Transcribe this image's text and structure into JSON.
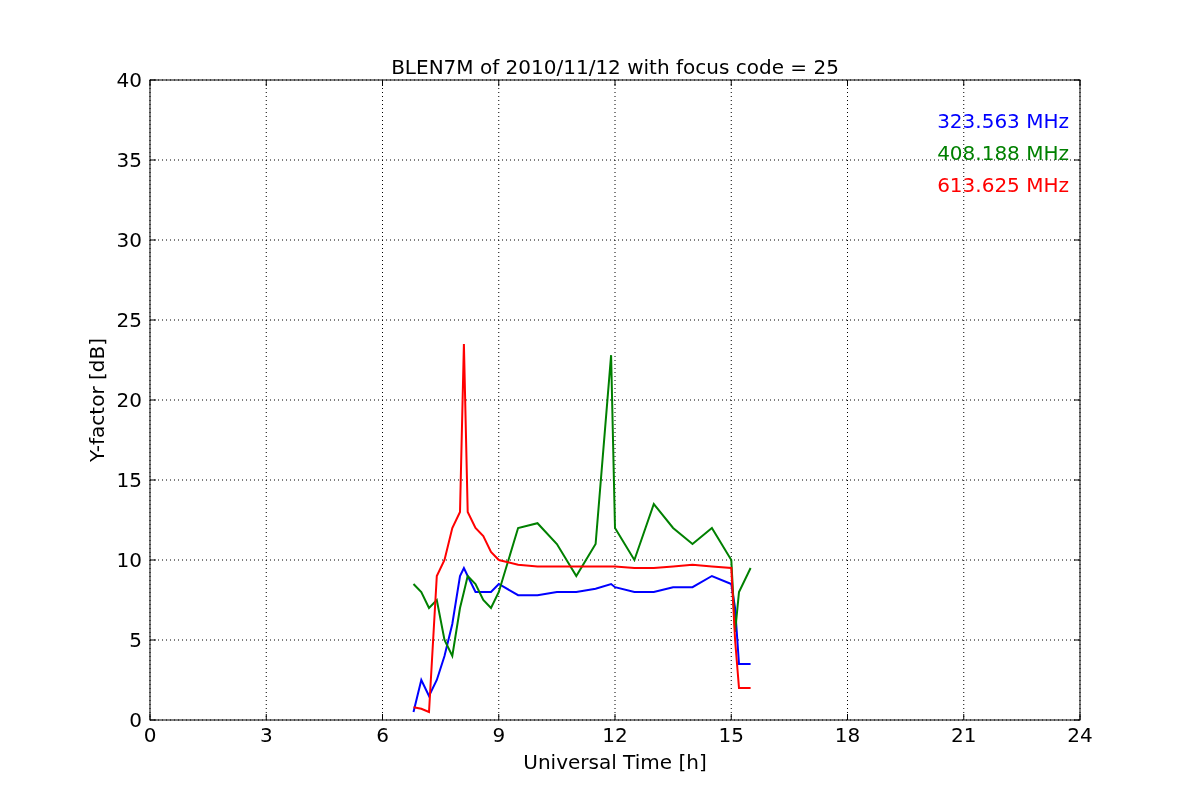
{
  "figure": {
    "chart_data": {
      "type": "line",
      "title": "BLEN7M of 2010/11/12 with focus code = 25",
      "xlabel": "Universal Time [h]",
      "ylabel": "Y-factor [dB]",
      "grid": true,
      "xlim": [
        0,
        24
      ],
      "ylim": [
        0,
        40
      ],
      "xticks": [
        0,
        3,
        6,
        9,
        12,
        15,
        18,
        21,
        24
      ],
      "yticks": [
        0,
        5,
        10,
        15,
        20,
        25,
        30,
        35,
        40
      ],
      "x": [
        6.8,
        7.0,
        7.2,
        7.4,
        7.6,
        7.8,
        8.0,
        8.1,
        8.2,
        8.4,
        8.6,
        8.8,
        9.0,
        9.5,
        10,
        10.5,
        11,
        11.5,
        11.9,
        12,
        12.5,
        13,
        13.5,
        14,
        14.5,
        15,
        15.1,
        15.2,
        15.5
      ],
      "series": [
        {
          "name": "323.563 MHz",
          "color": "#0000ff",
          "values": [
            0.5,
            2.5,
            1.5,
            2.5,
            4,
            6,
            9,
            9.5,
            9,
            8,
            8,
            8,
            8.5,
            7.8,
            7.8,
            8,
            8,
            8.2,
            8.5,
            8.3,
            8,
            8,
            8.3,
            8.3,
            9,
            8.5,
            7,
            3.5,
            3.5
          ]
        },
        {
          "name": "408.188 MHz",
          "color": "#008000",
          "values": [
            8.5,
            8,
            7,
            7.5,
            5,
            4,
            7,
            8,
            9,
            8.5,
            7.5,
            7,
            8,
            12,
            12.3,
            11,
            9,
            11,
            22.8,
            12,
            10,
            13.5,
            12,
            11,
            12,
            10,
            5.5,
            8,
            9.5
          ]
        },
        {
          "name": "613.625 MHz",
          "color": "#ff0000",
          "values": [
            0.8,
            0.7,
            0.5,
            9,
            10,
            12,
            13,
            23.5,
            13,
            12,
            11.5,
            10.5,
            10,
            9.7,
            9.6,
            9.6,
            9.6,
            9.6,
            9.6,
            9.6,
            9.5,
            9.5,
            9.6,
            9.7,
            9.6,
            9.5,
            5,
            2,
            2
          ]
        }
      ]
    }
  }
}
